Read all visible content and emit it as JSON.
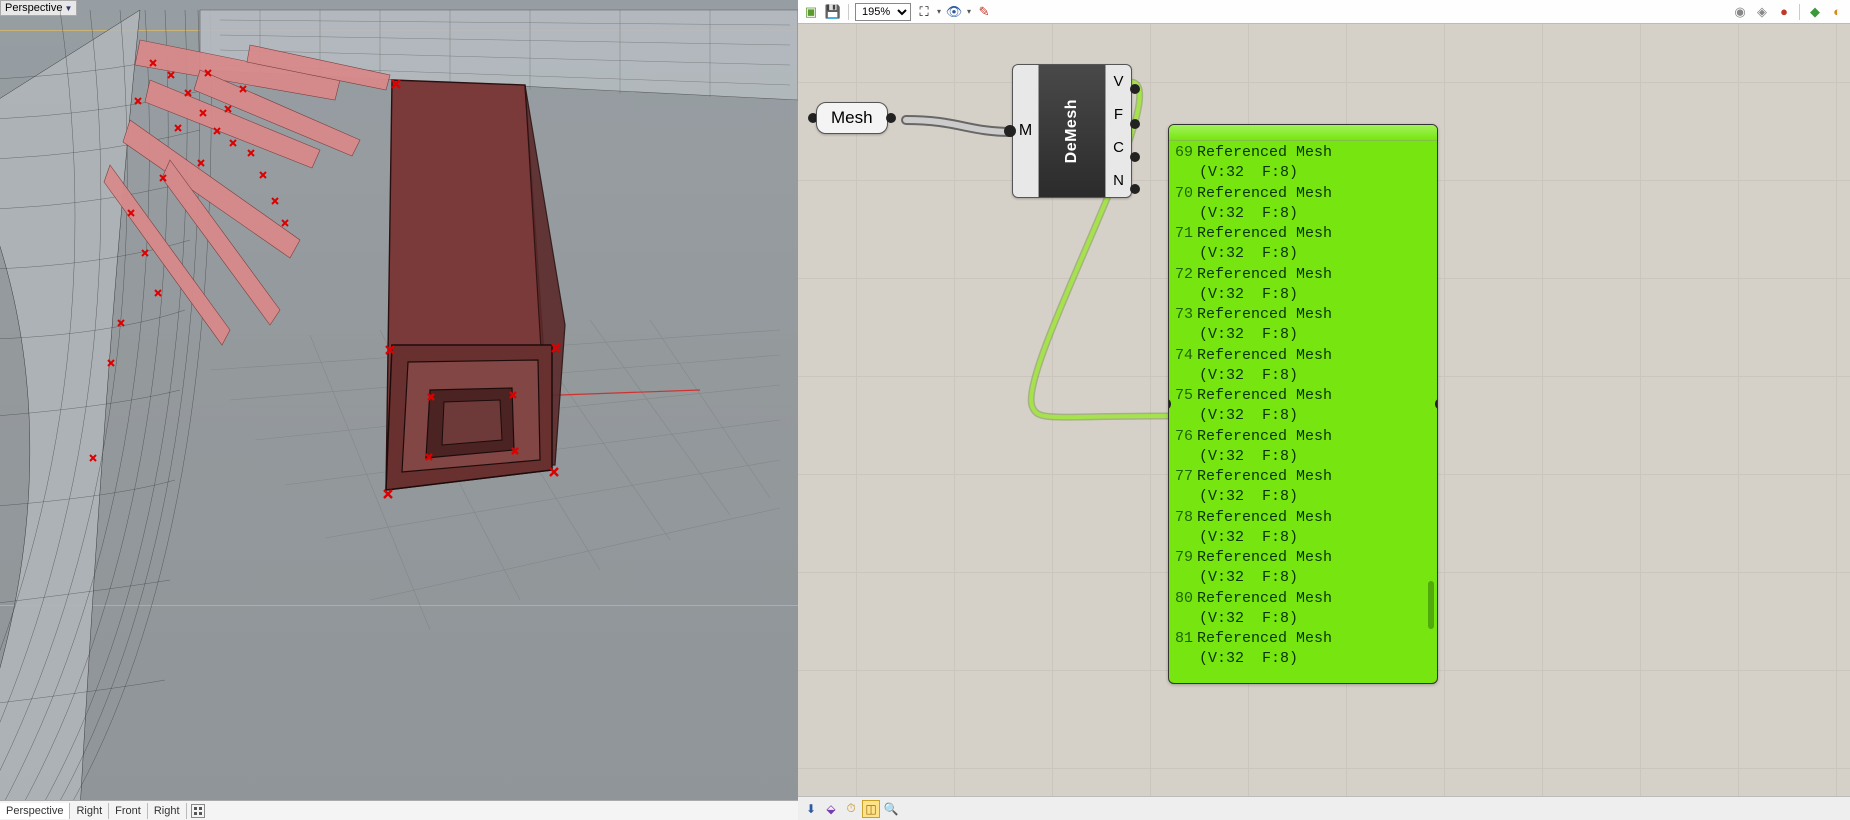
{
  "viewport": {
    "label": "Perspective",
    "tabs": [
      "Perspective",
      "Right",
      "Front",
      "Right"
    ]
  },
  "gh": {
    "zoom": "195%",
    "mesh_param_label": "Mesh",
    "demesh": {
      "title": "DeMesh",
      "in": "M",
      "out": [
        "V",
        "F",
        "C",
        "N"
      ]
    },
    "panel": {
      "start_index": 69,
      "end_index": 81,
      "item_label": "Referenced Mesh",
      "item_detail": "(V:32  F:8)"
    }
  },
  "bottom": {
    "status": ""
  }
}
